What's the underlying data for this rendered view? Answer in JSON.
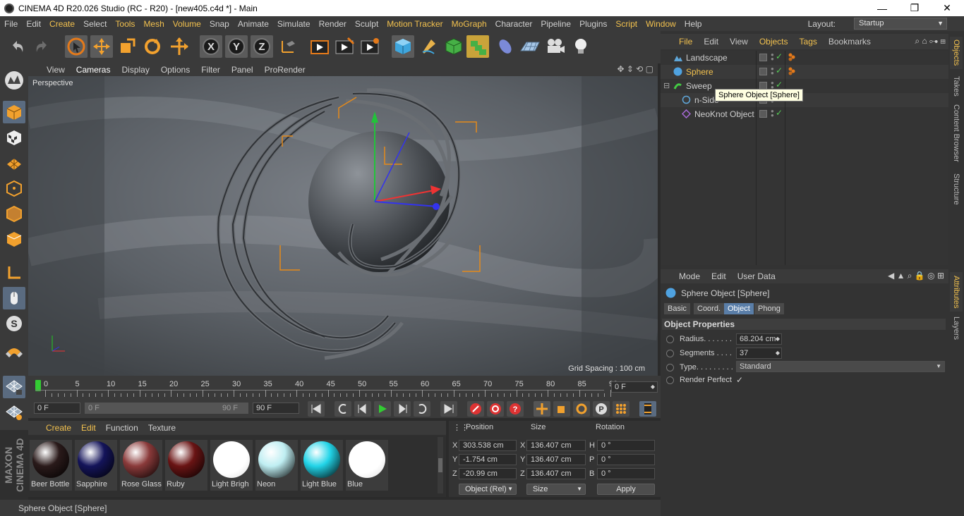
{
  "window": {
    "title": "CINEMA 4D R20.026 Studio (RC - R20) - [new405.c4d *] - Main",
    "minimize": "—",
    "restore": "❐",
    "close": "✕"
  },
  "menubar": [
    {
      "label": "File",
      "hl": false
    },
    {
      "label": "Edit",
      "hl": false
    },
    {
      "label": "Create",
      "hl": true
    },
    {
      "label": "Select",
      "hl": false
    },
    {
      "label": "Tools",
      "hl": true
    },
    {
      "label": "Mesh",
      "hl": true
    },
    {
      "label": "Volume",
      "hl": true
    },
    {
      "label": "Snap",
      "hl": false
    },
    {
      "label": "Animate",
      "hl": false
    },
    {
      "label": "Simulate",
      "hl": false
    },
    {
      "label": "Render",
      "hl": false
    },
    {
      "label": "Sculpt",
      "hl": false
    },
    {
      "label": "Motion Tracker",
      "hl": true
    },
    {
      "label": "MoGraph",
      "hl": true
    },
    {
      "label": "Character",
      "hl": false
    },
    {
      "label": "Pipeline",
      "hl": false
    },
    {
      "label": "Plugins",
      "hl": false
    },
    {
      "label": "Script",
      "hl": true
    },
    {
      "label": "Window",
      "hl": true
    },
    {
      "label": "Help",
      "hl": false
    }
  ],
  "layout": {
    "label": "Layout:",
    "value": "Startup"
  },
  "viewport": {
    "menu": [
      "View",
      "Cameras",
      "Display",
      "Options",
      "Filter",
      "Panel",
      "ProRender"
    ],
    "label": "Perspective",
    "grid_spacing": "Grid Spacing : 100 cm"
  },
  "timeline": {
    "ticks": [
      "0",
      "5",
      "10",
      "15",
      "20",
      "25",
      "30",
      "35",
      "40",
      "45",
      "50",
      "55",
      "60",
      "65",
      "70",
      "75",
      "80",
      "85",
      "90"
    ],
    "current_frame": "0 F"
  },
  "playback": {
    "start": "0 F",
    "range_start": "0 F",
    "range_end": "90 F",
    "end": "90 F"
  },
  "materials": {
    "menu": [
      "Create",
      "Edit",
      "Function",
      "Texture"
    ],
    "items": [
      {
        "label": "Beer Bottle",
        "color": "#2a1a1a"
      },
      {
        "label": "Sapphire",
        "color": "#14145a"
      },
      {
        "label": "Rose Glass",
        "color": "#8a3a3a"
      },
      {
        "label": "Ruby",
        "color": "#6a1414"
      },
      {
        "label": "Light Brigh",
        "color": "#ffffff"
      },
      {
        "label": "Neon",
        "color": "#bfeef2"
      },
      {
        "label": "Light Blue",
        "color": "#22d4e8"
      },
      {
        "label": "Blue",
        "color": "#ffffff"
      }
    ]
  },
  "coords": {
    "headers": [
      "Position",
      "Size",
      "Rotation"
    ],
    "rows": [
      {
        "axis": "X",
        "pos": "303.538 cm",
        "saxis": "X",
        "size": "136.407 cm",
        "raxis": "H",
        "rot": "0 °"
      },
      {
        "axis": "Y",
        "pos": "-1.754 cm",
        "saxis": "Y",
        "size": "136.407 cm",
        "raxis": "P",
        "rot": "0 °"
      },
      {
        "axis": "Z",
        "pos": "-20.99 cm",
        "saxis": "Z",
        "size": "136.407 cm",
        "raxis": "B",
        "rot": "0 °"
      }
    ],
    "mode": "Object (Rel)",
    "size_mode": "Size",
    "apply": "Apply"
  },
  "status": "Sphere Object [Sphere]",
  "objects": {
    "menu": [
      {
        "label": "File",
        "hl": true
      },
      {
        "label": "Edit",
        "hl": false
      },
      {
        "label": "View",
        "hl": false
      },
      {
        "label": "Objects",
        "hl": true
      },
      {
        "label": "Tags",
        "hl": true
      },
      {
        "label": "Bookmarks",
        "hl": false
      }
    ],
    "items": [
      {
        "name": "Landscape",
        "selected": false,
        "indent": 0
      },
      {
        "name": "Sphere",
        "selected": true,
        "indent": 0
      },
      {
        "name": "Sweep",
        "selected": false,
        "indent": 0
      },
      {
        "name": "n-Side",
        "selected": false,
        "indent": 1
      },
      {
        "name": "NeoKnot Object",
        "selected": false,
        "indent": 1
      }
    ],
    "tooltip": "Sphere Object [Sphere]"
  },
  "side_tabs": [
    "Objects",
    "Takes",
    "Content Browser",
    "Structure"
  ],
  "side_tabs_bottom": [
    "Attributes",
    "Layers"
  ],
  "attributes": {
    "menu": [
      "Mode",
      "Edit",
      "User Data"
    ],
    "title": "Sphere Object [Sphere]",
    "tabs": [
      "Basic",
      "Coord.",
      "Object",
      "Phong"
    ],
    "section": "Object Properties",
    "props": [
      {
        "label": "Radius. . . . . . .",
        "value": "68.204 cm"
      },
      {
        "label": "Segments . . . .",
        "value": "37"
      },
      {
        "label": "Type. . . . . . . . .",
        "value": "Standard"
      },
      {
        "label": "Render Perfect",
        "value": "✓"
      }
    ]
  },
  "brand": "MAXON CINEMA 4D"
}
